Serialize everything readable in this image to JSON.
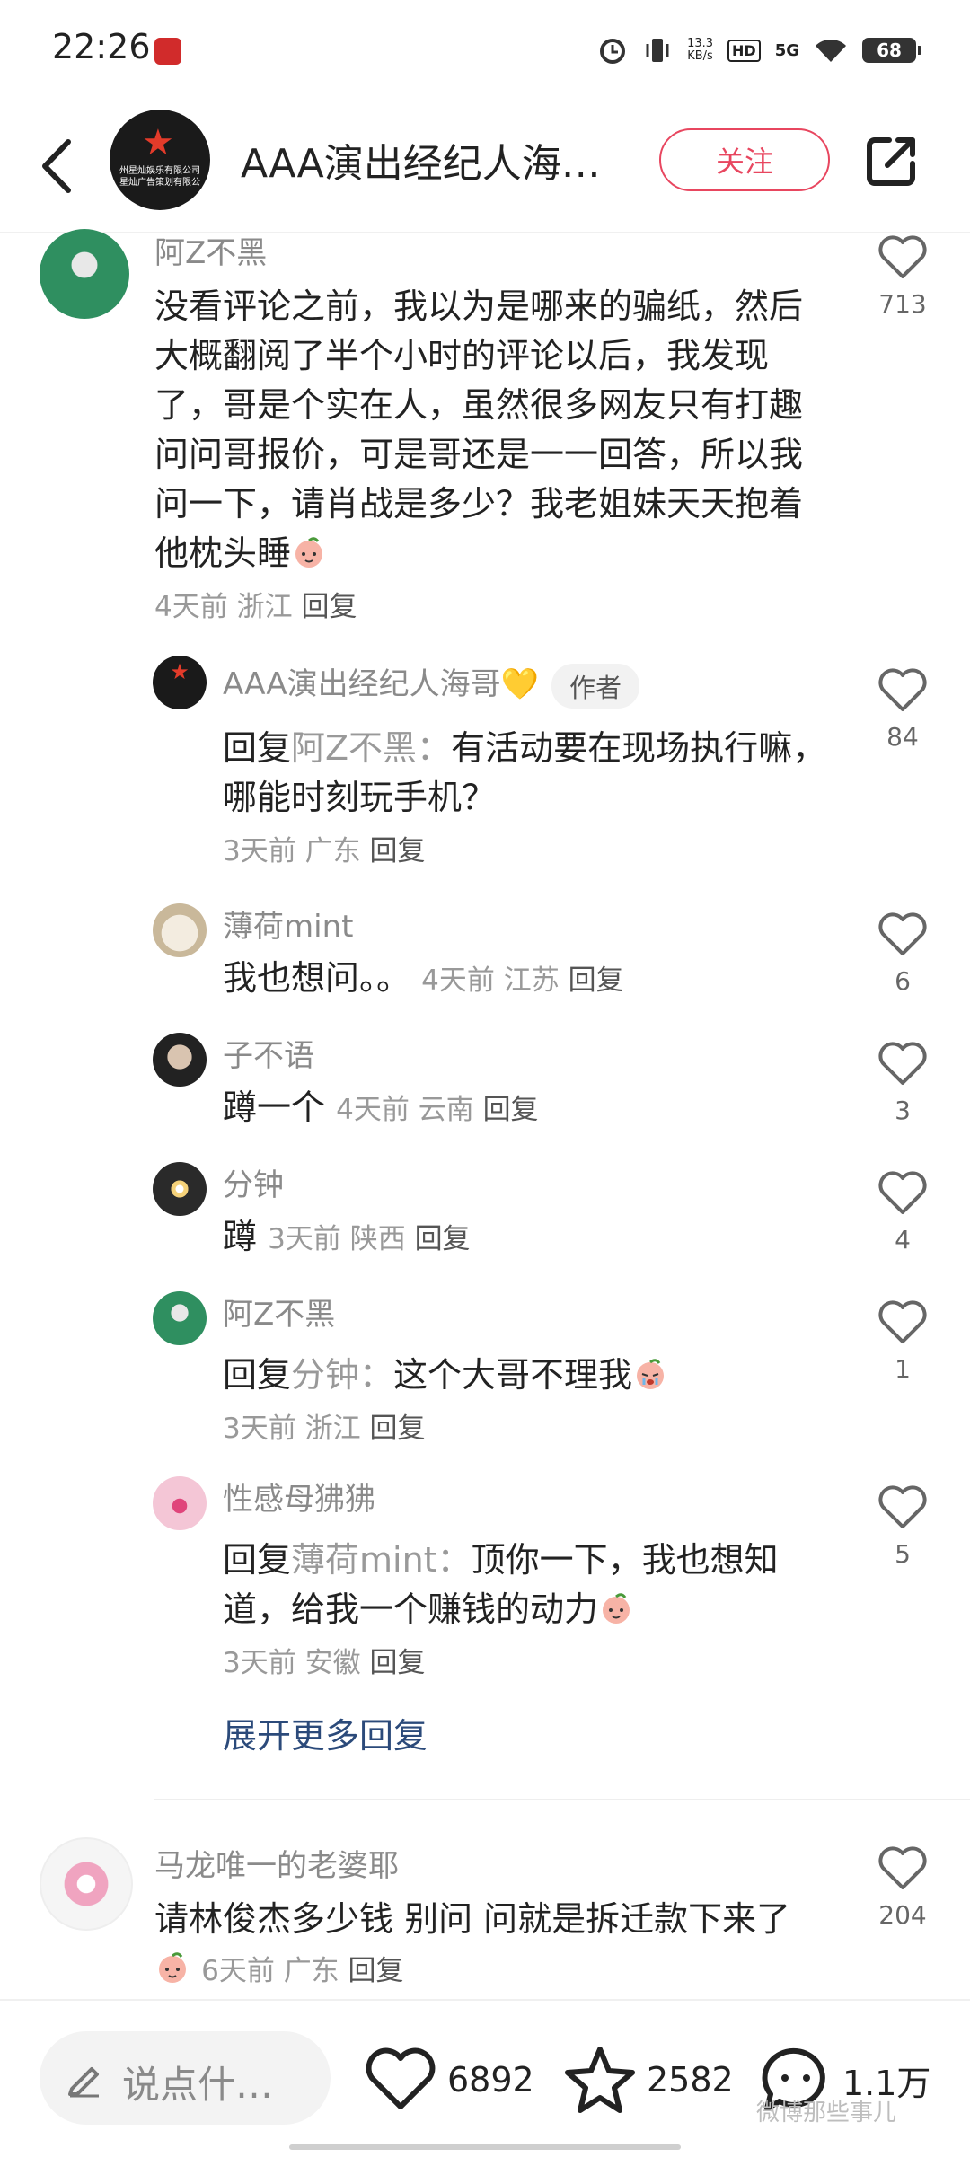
{
  "status_bar": {
    "time": "22:26",
    "net_speed_value": "13.3",
    "net_speed_unit": "KB/s",
    "hd": "HD",
    "signal": "5G",
    "battery": "68"
  },
  "header": {
    "title": "AAA演出经纪人海…",
    "follow_label": "关注",
    "avatar_text": "州星灿娱乐有限公司 星灿广告策划有限公"
  },
  "comments": [
    {
      "username": "阿Z不黑",
      "text": "没看评论之前，我以为是哪来的骗纸，然后大概翻阅了半个小时的评论以后，我发现了，哥是个实在人，虽然很多网友只有打趣问问哥报价，可是哥还是一一回答，所以我问一下，请肖战是多少？我老姐妹天天抱着他枕头睡",
      "time": "4天前",
      "location": "浙江",
      "reply_label": "回复",
      "likes": "713"
    },
    {
      "username": "AAA演出经纪人海哥💛",
      "badge": "作者",
      "reply_prefix": "回复",
      "reply_to": "阿Z不黑：",
      "text": "有活动要在现场执行嘛，哪能时刻玩手机？",
      "time": "3天前",
      "location": "广东",
      "reply_label": "回复",
      "likes": "84"
    },
    {
      "username": "薄荷mint",
      "text": "我也想问。。",
      "time": "4天前",
      "location": "江苏",
      "reply_label": "回复",
      "likes": "6"
    },
    {
      "username": "子不语",
      "text": "蹲一个",
      "time": "4天前",
      "location": "云南",
      "reply_label": "回复",
      "likes": "3"
    },
    {
      "username": "分钟",
      "text": "蹲",
      "time": "3天前",
      "location": "陕西",
      "reply_label": "回复",
      "likes": "4"
    },
    {
      "username": "阿Z不黑",
      "reply_prefix": "回复",
      "reply_to": "分钟：",
      "text": "这个大哥不理我",
      "time": "3天前",
      "location": "浙江",
      "reply_label": "回复",
      "likes": "1"
    },
    {
      "username": "性感母狒狒",
      "reply_prefix": "回复",
      "reply_to": "薄荷mint：",
      "text": "顶你一下，我也想知道，给我一个赚钱的动力",
      "time": "3天前",
      "location": "安徽",
      "reply_label": "回复",
      "likes": "5"
    },
    {
      "username": "马龙唯一的老婆耶",
      "text": "请林俊杰多少钱 别问 问就是拆迁款下来了",
      "time": "6天前",
      "location": "广东",
      "reply_label": "回复",
      "likes": "204"
    }
  ],
  "expand_more": "展开更多回复",
  "bottom_bar": {
    "input_placeholder": "说点什…",
    "likes": "6892",
    "favorites": "2582",
    "comments": "1.1万",
    "watermark": "微博那些事儿"
  },
  "colors": {
    "accent": "#e8465f",
    "link": "#2b4a7a",
    "meta": "#999999"
  },
  "icons": [
    "back-arrow-icon",
    "share-icon",
    "heart-icon",
    "star-icon",
    "chat-bubble-icon",
    "pen-icon",
    "alarm-icon",
    "vibrate-icon",
    "wifi-icon"
  ]
}
